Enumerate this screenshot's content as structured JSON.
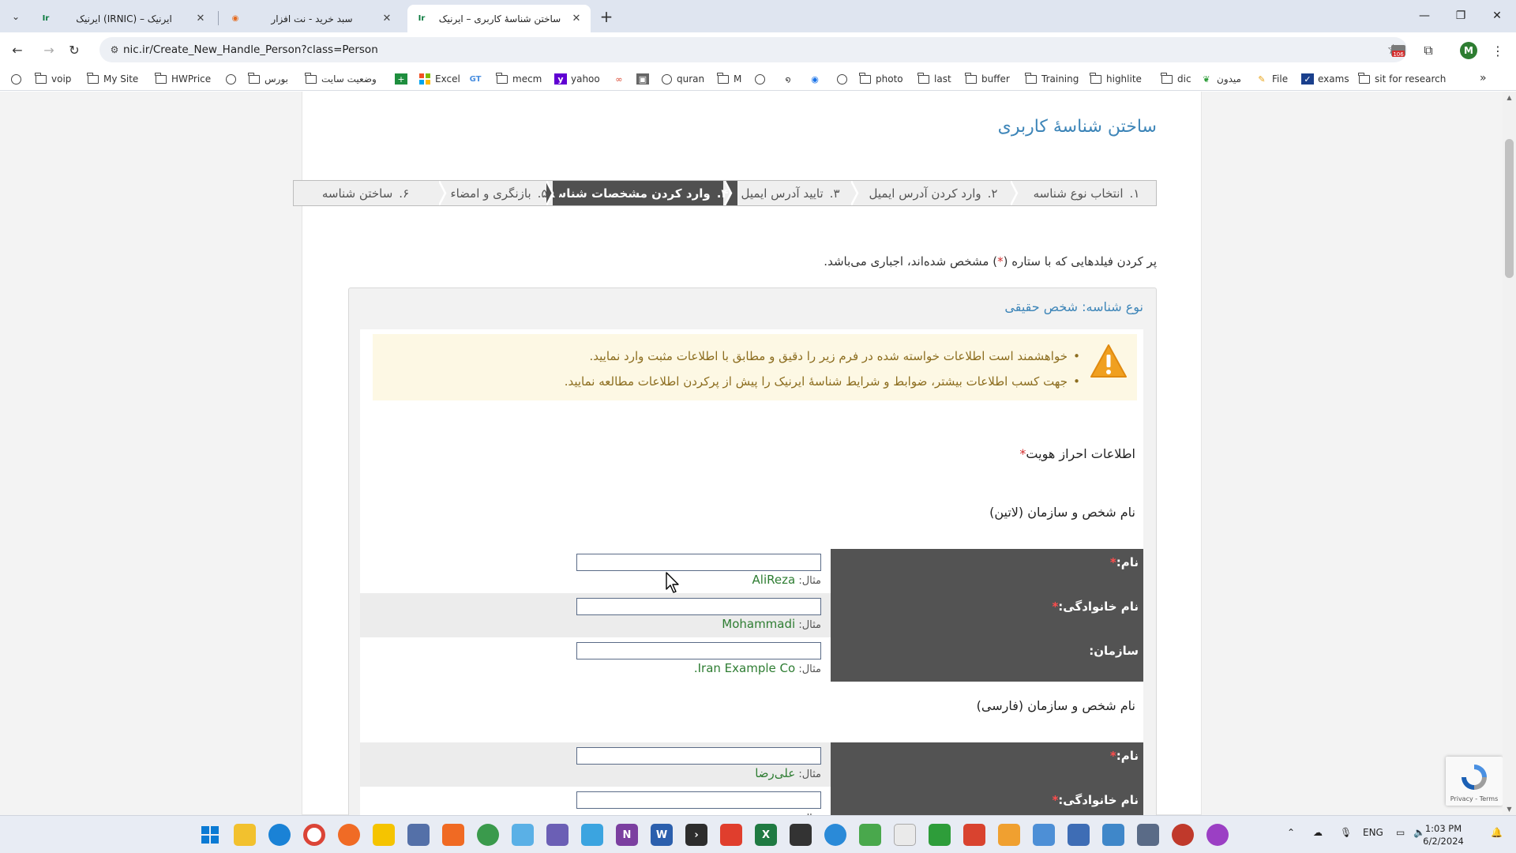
{
  "browser": {
    "tabs": [
      {
        "title": "ایرنیک (IRNIC) – ایرنیک",
        "active": false
      },
      {
        "title": "سبد خرید - نت افزار",
        "active": false
      },
      {
        "title": "ساختن شناسهٔ کاربری – ایرنیک",
        "active": true
      }
    ],
    "url": "nic.ir/Create_New_Handle_Person?class=Person",
    "profile_initial": "M",
    "extension_badge": "106",
    "bookmarks": [
      {
        "label": "",
        "icon": "globe-icon"
      },
      {
        "label": "voip",
        "icon": "folder-icon"
      },
      {
        "label": "My Site",
        "icon": "folder-icon"
      },
      {
        "label": "HWPrice",
        "icon": "folder-icon"
      },
      {
        "label": "",
        "icon": "globe-icon"
      },
      {
        "label": "بورس",
        "icon": "folder-icon"
      },
      {
        "label": "وضعیت سایت",
        "icon": "folder-icon"
      },
      {
        "label": "",
        "icon": "sheets-icon"
      },
      {
        "label": "Excel",
        "icon": "excel-grid-icon"
      },
      {
        "label": "",
        "icon": "gt-icon"
      },
      {
        "label": "mecm",
        "icon": "folder-icon"
      },
      {
        "label": "yahoo",
        "icon": "yahoo-icon"
      },
      {
        "label": "",
        "icon": "link-icon"
      },
      {
        "label": "",
        "icon": "app-icon"
      },
      {
        "label": "quran",
        "icon": "globe-icon"
      },
      {
        "label": "M",
        "icon": "folder-icon"
      },
      {
        "label": "",
        "icon": "globe-icon"
      },
      {
        "label": "",
        "icon": "swirl-icon"
      },
      {
        "label": "",
        "icon": "blue-globe-icon"
      },
      {
        "label": "",
        "icon": "globe-icon"
      },
      {
        "label": "photo",
        "icon": "folder-icon"
      },
      {
        "label": "last",
        "icon": "folder-icon"
      },
      {
        "label": "buffer",
        "icon": "folder-icon"
      },
      {
        "label": "Training",
        "icon": "folder-icon"
      },
      {
        "label": "highlite",
        "icon": "folder-icon"
      },
      {
        "label": "dic",
        "icon": "folder-icon"
      },
      {
        "label": "میدون",
        "icon": "green-leaf-icon"
      },
      {
        "label": "File",
        "icon": "edit-icon"
      },
      {
        "label": "exams",
        "icon": "checkbox-icon"
      },
      {
        "label": "sit for research",
        "icon": "folder-icon"
      }
    ]
  },
  "page": {
    "title": "ساختن شناسهٔ کاربری",
    "steps": [
      {
        "num": "۱.",
        "label": "انتخاب نوع شناسه",
        "active": false
      },
      {
        "num": "۲.",
        "label": "وارد کردن آدرس ایمیل",
        "active": false
      },
      {
        "num": "۳.",
        "label": "تایید آدرس ایمیل",
        "active": false
      },
      {
        "num": "۴.",
        "label": "وارد کردن مشخصات شناسه",
        "active": true
      },
      {
        "num": "۵.",
        "label": "بازنگری و امضاء",
        "active": false
      },
      {
        "num": "۶.",
        "label": "ساختن شناسه",
        "active": false
      }
    ],
    "required_note_before": "پر کردن فیلدهایی که با ستاره (",
    "required_star": "*",
    "required_note_after": ") مشخص شده‌اند، اجباری می‌باشد.",
    "panel_title": "نوع شناسه: شخص حقیقی",
    "warnings": [
      "خواهشمند است اطلاعات خواسته شده در فرم زیر را دقیق و مطابق با اطلاعات مثبت وارد نمایید.",
      "جهت کسب اطلاعات بیشتر، ضوابط و شرایط شناسهٔ ایرنیک را پیش از پرکردن اطلاعات مطالعه نمایید."
    ],
    "identity_section": "اطلاعات احراز هویت",
    "latin_section": "نام شخص و سازمان (لاتین)",
    "persian_section": "نام شخص و سازمان (فارسی)",
    "example_prefix": "مثال:",
    "latin_fields": [
      {
        "label": "نام:",
        "required": true,
        "value": "",
        "example": "AliReza"
      },
      {
        "label": "نام خانوادگی:",
        "required": true,
        "value": "",
        "example": "Mohammadi"
      },
      {
        "label": "سازمان:",
        "required": false,
        "value": "",
        "example": "Iran Example Co."
      }
    ],
    "persian_fields": [
      {
        "label": "نام:",
        "required": true,
        "value": "",
        "example": "علی‌رضا"
      },
      {
        "label": "نام خانوادگی:",
        "required": true,
        "value": "",
        "example": "محمدی"
      }
    ],
    "recaptcha_text": "Privacy - Terms"
  },
  "taskbar": {
    "language": "ENG",
    "time": "1:03 PM",
    "date": "6/2/2024"
  }
}
